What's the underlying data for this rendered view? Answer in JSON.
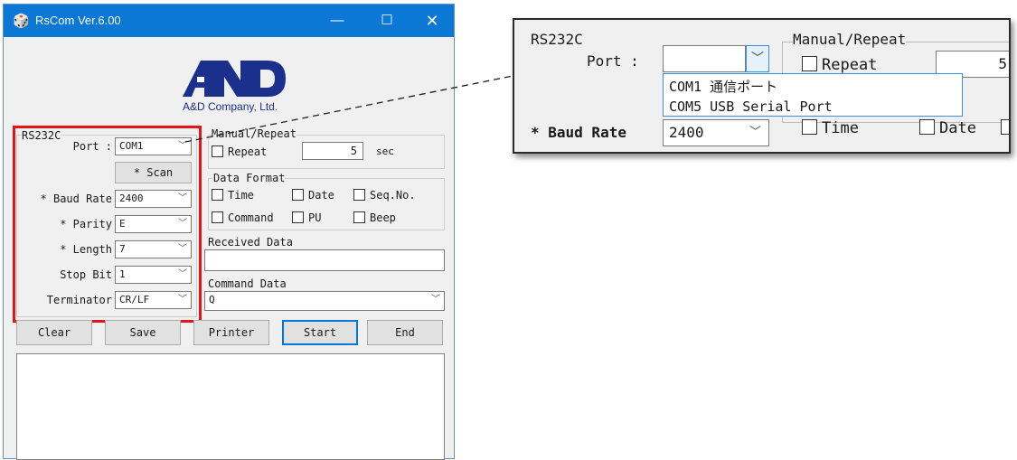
{
  "window": {
    "title": "RsCom Ver.6.00",
    "app_icon": "🎲",
    "buttons": {
      "minimize": "—",
      "maximize": "☐",
      "close": "✕"
    }
  },
  "logo": {
    "mark": "AND",
    "company": "A&D Company, Ltd.",
    "color": "#1b2f8c"
  },
  "rs232c": {
    "title": "RS232C",
    "port_label": "Port :",
    "port_value": "COM1",
    "scan_label": "* Scan",
    "baud_label": "* Baud Rate",
    "baud_value": "2400",
    "parity_label": "* Parity",
    "parity_value": "E",
    "length_label": "* Length",
    "length_value": "7",
    "stopbit_label": "Stop Bit",
    "stopbit_value": "1",
    "terminator_label": "Terminator",
    "terminator_value": "CR/LF"
  },
  "manual": {
    "title": "Manual/Repeat",
    "repeat_label": "Repeat",
    "interval": "5",
    "unit": "sec"
  },
  "data_format": {
    "title": "Data Format",
    "time": "Time",
    "date": "Date",
    "seq": "Seq.No.",
    "command": "Command",
    "pu": "PU",
    "beep": "Beep"
  },
  "received": {
    "title": "Received Data",
    "value": ""
  },
  "command": {
    "title": "Command Data",
    "value": "Q"
  },
  "buttons": {
    "clear": "Clear",
    "save": "Save",
    "printer": "Printer",
    "start": "Start",
    "end": "End"
  },
  "inset": {
    "rs232c_title": "RS232C",
    "port_label": "Port :",
    "manual_title": "Manual/Repeat",
    "repeat_label": "Repeat",
    "interval": "5",
    "options": [
      "COM1  通信ポート",
      "COM5  USB Serial Port"
    ],
    "baud_label": "* Baud Rate",
    "baud_value": "2400",
    "time": "Time",
    "date": "Date"
  },
  "colors": {
    "titlebar": "#0a78d4",
    "highlight": "#e0161a",
    "logo": "#1b2f8c"
  }
}
